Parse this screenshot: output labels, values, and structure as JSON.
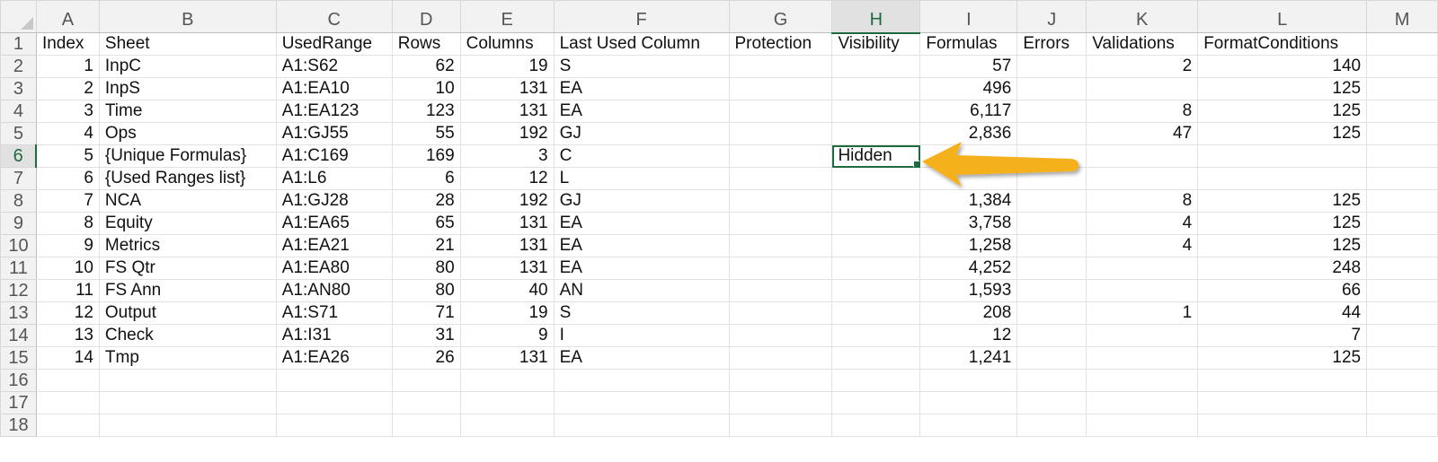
{
  "columns": [
    "A",
    "B",
    "C",
    "D",
    "E",
    "F",
    "G",
    "H",
    "I",
    "J",
    "K",
    "L",
    "M"
  ],
  "active_cell": {
    "column": "H",
    "row": 6
  },
  "header_row": [
    "Index",
    "Sheet",
    "UsedRange",
    "Rows",
    "Columns",
    "Last Used Column",
    "Protection",
    "Visibility",
    "Formulas",
    "Errors",
    "Validations",
    "FormatConditions",
    ""
  ],
  "rows": [
    [
      "1",
      "InpC",
      "A1:S62",
      "62",
      "19",
      "S",
      "",
      "",
      "57",
      "",
      "2",
      "140",
      ""
    ],
    [
      "2",
      "InpS",
      "A1:EA10",
      "10",
      "131",
      "EA",
      "",
      "",
      "496",
      "",
      "",
      "125",
      ""
    ],
    [
      "3",
      "Time",
      "A1:EA123",
      "123",
      "131",
      "EA",
      "",
      "",
      "6,117",
      "",
      "8",
      "125",
      ""
    ],
    [
      "4",
      "Ops",
      "A1:GJ55",
      "55",
      "192",
      "GJ",
      "",
      "",
      "2,836",
      "",
      "47",
      "125",
      ""
    ],
    [
      "5",
      "{Unique Formulas}",
      "A1:C169",
      "169",
      "3",
      "C",
      "",
      "Hidden",
      "",
      "",
      "",
      "",
      ""
    ],
    [
      "6",
      "{Used Ranges list}",
      "A1:L6",
      "6",
      "12",
      "L",
      "",
      "",
      "",
      "",
      "",
      "",
      ""
    ],
    [
      "7",
      "NCA",
      "A1:GJ28",
      "28",
      "192",
      "GJ",
      "",
      "",
      "1,384",
      "",
      "8",
      "125",
      ""
    ],
    [
      "8",
      "Equity",
      "A1:EA65",
      "65",
      "131",
      "EA",
      "",
      "",
      "3,758",
      "",
      "4",
      "125",
      ""
    ],
    [
      "9",
      "Metrics",
      "A1:EA21",
      "21",
      "131",
      "EA",
      "",
      "",
      "1,258",
      "",
      "4",
      "125",
      ""
    ],
    [
      "10",
      "FS Qtr",
      "A1:EA80",
      "80",
      "131",
      "EA",
      "",
      "",
      "4,252",
      "",
      "",
      "248",
      ""
    ],
    [
      "11",
      "FS Ann",
      "A1:AN80",
      "80",
      "40",
      "AN",
      "",
      "",
      "1,593",
      "",
      "",
      "66",
      ""
    ],
    [
      "12",
      "Output",
      "A1:S71",
      "71",
      "19",
      "S",
      "",
      "",
      "208",
      "",
      "1",
      "44",
      ""
    ],
    [
      "13",
      "Check",
      "A1:I31",
      "31",
      "9",
      "I",
      "",
      "",
      "12",
      "",
      "",
      "7",
      ""
    ],
    [
      "14",
      "Tmp",
      "A1:EA26",
      "26",
      "131",
      "EA",
      "",
      "",
      "1,241",
      "",
      "",
      "125",
      ""
    ],
    [
      "",
      "",
      "",
      "",
      "",
      "",
      "",
      "",
      "",
      "",
      "",
      "",
      ""
    ],
    [
      "",
      "",
      "",
      "",
      "",
      "",
      "",
      "",
      "",
      "",
      "",
      "",
      ""
    ],
    [
      "",
      "",
      "",
      "",
      "",
      "",
      "",
      "",
      "",
      "",
      "",
      "",
      ""
    ]
  ],
  "annotation": {
    "type": "arrow",
    "color": "#F5B11C",
    "points_to": "H6"
  },
  "colors": {
    "accent": "#1E6B41",
    "header_bg": "#F2F2F2",
    "gridline": "#E1E1E1"
  }
}
